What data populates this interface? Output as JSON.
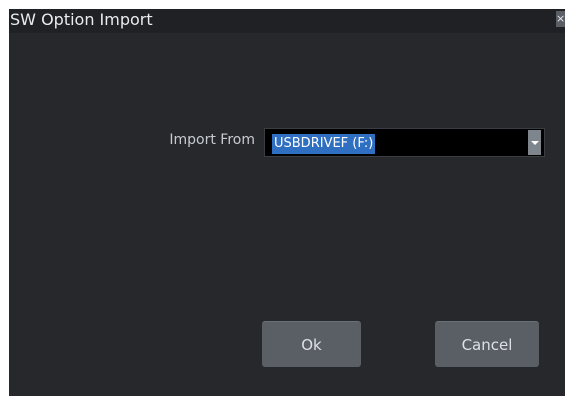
{
  "dialog": {
    "title": "SW Option Import",
    "close_label": "×"
  },
  "import_from": {
    "label": "Import From",
    "selected_value": "USBDRIVEF (F:)",
    "dropdown_icon": "chevron-down-icon"
  },
  "buttons": {
    "ok_label": "Ok",
    "cancel_label": "Cancel"
  },
  "colors": {
    "dialog_background": "#26282b",
    "selection_highlight": "#2f6fc1",
    "button_background": "#5a5f66"
  }
}
